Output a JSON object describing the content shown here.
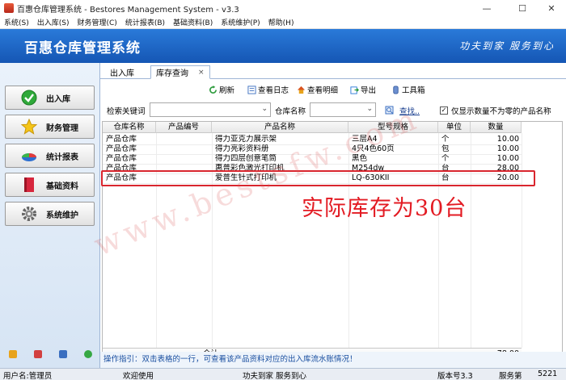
{
  "window": {
    "title": "百惠仓库管理系统 - Bestores Management System - v3.3",
    "controls": [
      "—",
      "☐",
      "✕"
    ]
  },
  "menu": [
    "系统(S)",
    "出入库(S)",
    "财务管理(C)",
    "统计报表(B)",
    "基础资料(B)",
    "系统维护(P)",
    "帮助(H)"
  ],
  "banner": {
    "title": "百惠仓库管理系统",
    "slogan": "功夫到家 服务到心"
  },
  "nav": [
    {
      "label": "出入库",
      "icon": "check-circle-icon"
    },
    {
      "label": "财务管理",
      "icon": "star-icon"
    },
    {
      "label": "统计报表",
      "icon": "pie-chart-icon"
    },
    {
      "label": "基础资料",
      "icon": "book-icon"
    },
    {
      "label": "系统维护",
      "icon": "gear-icon"
    }
  ],
  "tabs": [
    {
      "label": "出入库"
    },
    {
      "label": "库存查询",
      "close": "×"
    }
  ],
  "toolbar": [
    {
      "label": "刷新",
      "icon": "refresh-icon"
    },
    {
      "label": "查看日志",
      "icon": "log-icon"
    },
    {
      "label": "查看明细",
      "icon": "home-icon"
    },
    {
      "label": "导出",
      "icon": "export-icon"
    },
    {
      "label": "工具箱",
      "icon": "toolbox-icon"
    }
  ],
  "search": {
    "keyword_label": "检索关键词",
    "keyword_value": "",
    "warehouse_label": "仓库名称",
    "warehouse_value": "",
    "find_label": "查找..",
    "checkbox_label": "仅显示数量不为零的产品名称",
    "checkbox_checked": true,
    "checkbox_mark": "✓"
  },
  "table": {
    "columns": [
      "仓库名称",
      "产品编号",
      "产品名称",
      "型号规格",
      "单位",
      "数量"
    ],
    "rows": [
      [
        "产品仓库",
        "",
        "得力亚克力展示架",
        "三层A4",
        "个",
        "10.00"
      ],
      [
        "产品仓库",
        "",
        "得力亮彩资料册",
        "4只4色60页",
        "包",
        "10.00"
      ],
      [
        "产品仓库",
        "",
        "得力四层创意笔筒",
        "黑色",
        "个",
        "10.00"
      ],
      [
        "产品仓库",
        "",
        "惠普彩色激光打印机",
        "M254dw",
        "台",
        "28.00"
      ],
      [
        "产品仓库",
        "",
        "爱普生针式打印机",
        "LQ-630KII",
        "台",
        "20.00"
      ]
    ],
    "footer_label": "合计",
    "footer_total": "78.00"
  },
  "annotation": "实际库存为30台",
  "watermark": "www.bestsfw.com",
  "hint": "操作指引：双击表格的一行，可查看该产品资料对应的出入库流水账情况！",
  "status": {
    "user": "用户名:管理员",
    "welcome": "欢迎使用",
    "slogan": "功夫到家 服务到心",
    "version": "版本号3.3",
    "service": "服务第",
    "code": "5221"
  },
  "colors": {
    "banner": "#1e6ac6",
    "highlight": "#d9262e",
    "annotation": "#e31b23"
  }
}
